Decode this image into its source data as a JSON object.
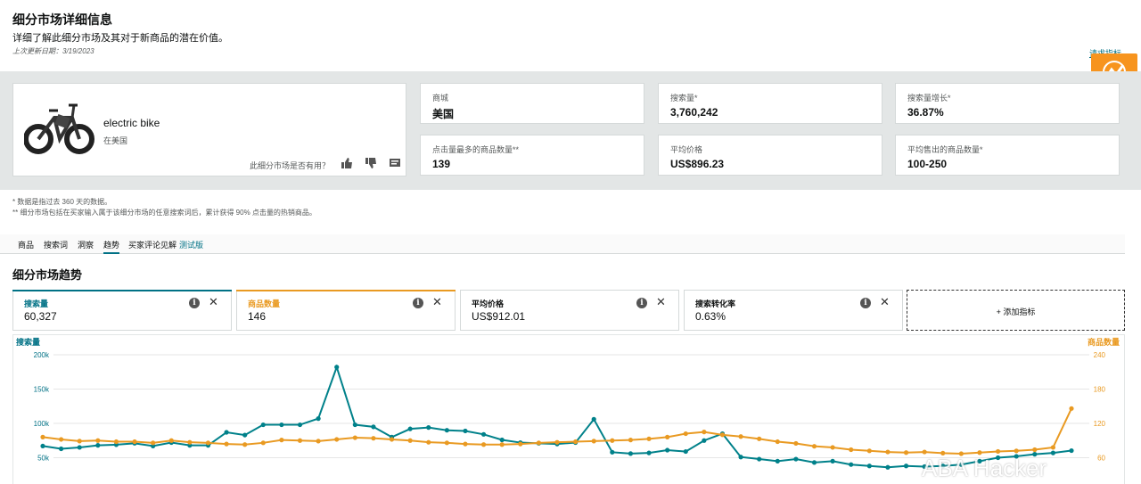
{
  "header": {
    "title": "细分市场详细信息",
    "subtitle": "详细了解此细分市场及其对于新商品的潜在价值。",
    "last_updated": "上次更新日期：3/19/2023",
    "request_link": "请求指标"
  },
  "product": {
    "name": "electric bike",
    "location": "在美国",
    "useful_prompt": "此细分市场是否有用？",
    "icons": [
      "thumbs-up-icon",
      "thumbs-down-icon",
      "comment-icon"
    ]
  },
  "stats": [
    {
      "label": "商城",
      "value": "美国"
    },
    {
      "label": "搜索量*",
      "value": "3,760,242"
    },
    {
      "label": "搜索量增长*",
      "value": "36.87%"
    },
    {
      "label": "点击量最多的商品数量**",
      "value": "139"
    },
    {
      "label": "平均价格",
      "value": "US$896.23"
    },
    {
      "label": "平均售出的商品数量*",
      "value": "100-250"
    }
  ],
  "notes": [
    "* 数据是指过去 360 天的数据。",
    "** 细分市场包括在买家输入属于该细分市场的任意搜索词后，累计获得 90% 点击量的热销商品。"
  ],
  "tabs": [
    {
      "label": "商品"
    },
    {
      "label": "搜索词"
    },
    {
      "label": "洞察"
    },
    {
      "label": "趋势",
      "active": true
    },
    {
      "label": "买家评论见解",
      "beta": "测试版"
    }
  ],
  "section_title": "细分市场趋势",
  "metric_cards": [
    {
      "label": "搜索量",
      "value": "60,327",
      "color": "#007185"
    },
    {
      "label": "商品数量",
      "value": "146",
      "color": "#e99a22"
    },
    {
      "label": "平均价格",
      "value": "US$912.01",
      "color": "#d5d9d9"
    },
    {
      "label": "搜索转化率",
      "value": "0.63%",
      "color": "#d5d9d9"
    }
  ],
  "add_metric": "+ 添加指标",
  "watermark": "ABA Hacker",
  "chart_data": {
    "type": "line",
    "left_axis_label": "搜索量",
    "right_axis_label": "商品数量",
    "left_ticks": [
      "200k",
      "150k",
      "100k",
      "50k"
    ],
    "right_ticks": [
      "240",
      "180",
      "120",
      "60"
    ],
    "left_ylim": [
      0,
      200000
    ],
    "right_ylim": [
      0,
      240
    ],
    "series": [
      {
        "name": "搜索量",
        "axis": "left",
        "color": "#00818a",
        "values": [
          67000,
          63000,
          65000,
          68000,
          69000,
          71000,
          67000,
          72000,
          68000,
          68000,
          87000,
          83000,
          98000,
          98000,
          98000,
          107000,
          182000,
          98000,
          95000,
          80000,
          92000,
          94000,
          90000,
          89000,
          84000,
          76000,
          72000,
          71000,
          70000,
          72000,
          106000,
          58000,
          56000,
          57000,
          61000,
          59000,
          75000,
          85000,
          51000,
          48000,
          45000,
          48000,
          43000,
          45000,
          40000,
          38000,
          36000,
          38000,
          37000,
          38000,
          40000,
          45000,
          50000,
          52000,
          55000,
          57000,
          60327
        ]
      },
      {
        "name": "商品数量",
        "axis": "right",
        "color": "#e99a22",
        "values": [
          96,
          92,
          89,
          90,
          88,
          88,
          86,
          90,
          87,
          86,
          84,
          83,
          86,
          91,
          90,
          89,
          92,
          95,
          94,
          92,
          90,
          87,
          86,
          84,
          83,
          83,
          84,
          86,
          87,
          88,
          89,
          90,
          91,
          93,
          96,
          102,
          105,
          100,
          97,
          93,
          88,
          85,
          80,
          78,
          74,
          72,
          70,
          69,
          70,
          68,
          67,
          69,
          71,
          72,
          74,
          78,
          146
        ]
      }
    ]
  }
}
